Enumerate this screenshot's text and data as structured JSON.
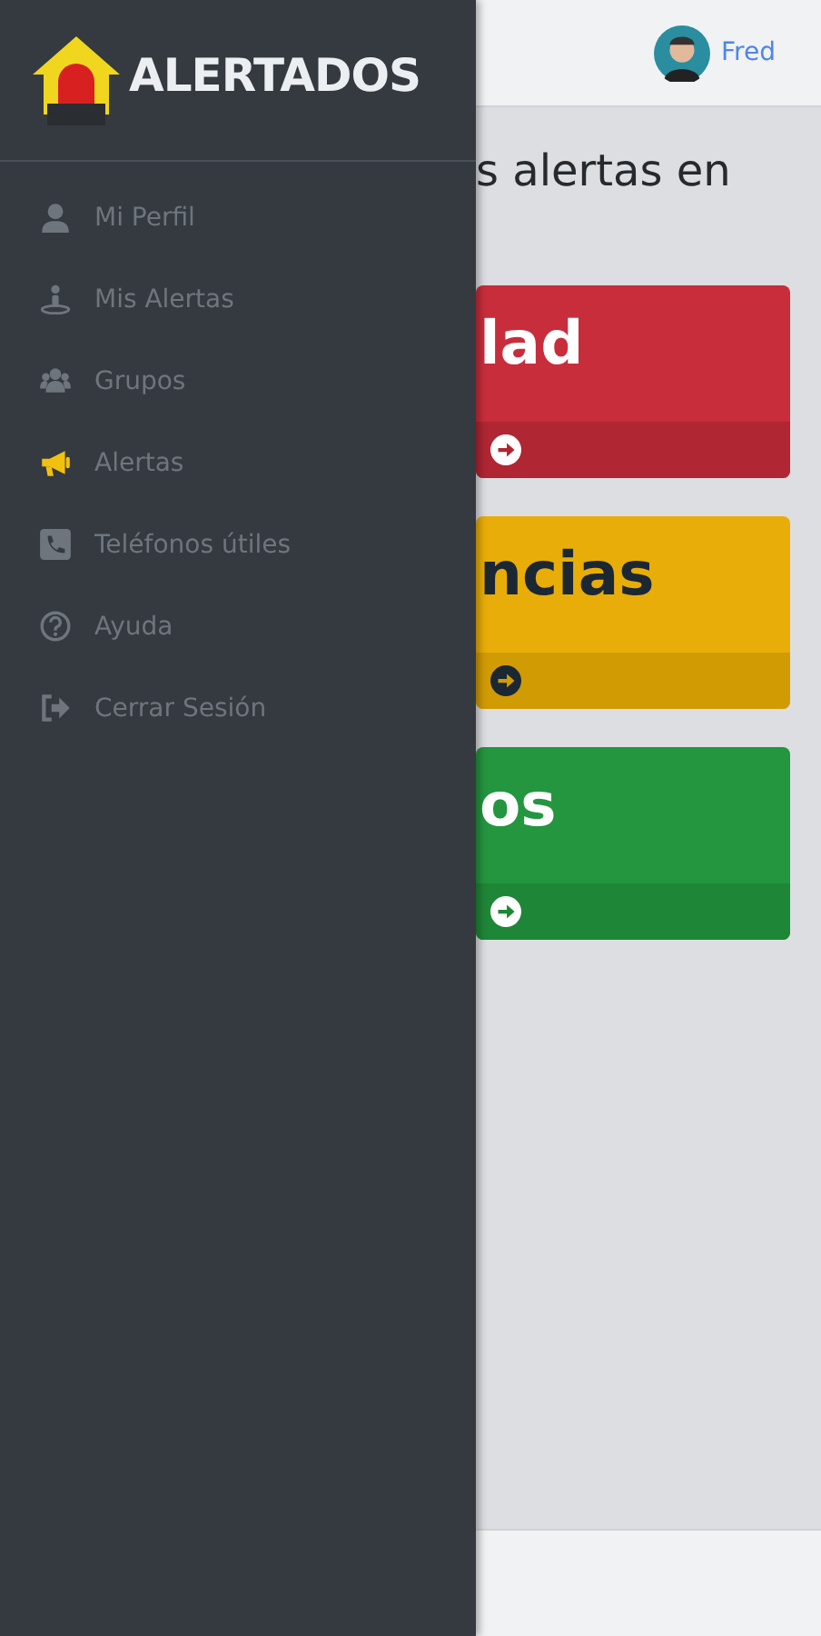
{
  "header": {
    "user_name": "Fred"
  },
  "drawer": {
    "logo_text": "ALERTADOS",
    "items": [
      {
        "label": "Mi Perfil",
        "kind": "user",
        "selected": false
      },
      {
        "label": "Mis Alertas",
        "kind": "pin",
        "selected": false
      },
      {
        "label": "Grupos",
        "kind": "users",
        "selected": false
      },
      {
        "label": "Alertas",
        "kind": "megaphone",
        "selected": true
      },
      {
        "label": "Teléfonos útiles",
        "kind": "phone",
        "selected": false
      },
      {
        "label": "Ayuda",
        "kind": "help",
        "selected": false
      },
      {
        "label": "Cerrar Sesión",
        "kind": "logout",
        "selected": false
      }
    ]
  },
  "main": {
    "heading": "s alertas en",
    "cards": [
      {
        "kind": "danger",
        "title": "lad"
      },
      {
        "kind": "warning",
        "title": "ncias"
      },
      {
        "kind": "success",
        "title": "os"
      }
    ]
  }
}
